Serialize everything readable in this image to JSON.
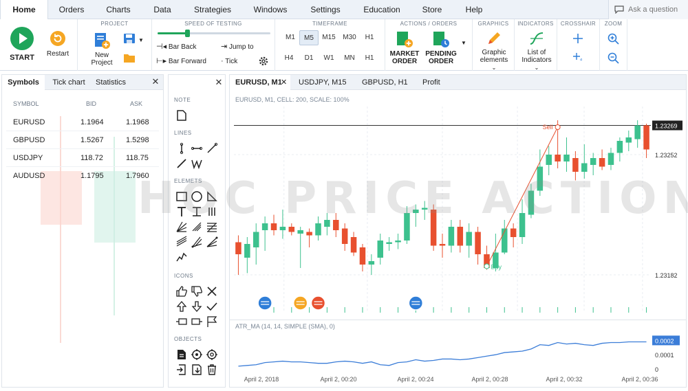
{
  "menu": {
    "items": [
      "Home",
      "Orders",
      "Charts",
      "Data",
      "Strategies",
      "Windows",
      "Settings",
      "Education",
      "Store",
      "Help"
    ],
    "ask": "Ask a question"
  },
  "toolbar": {
    "start": "START",
    "restart": "Restart",
    "project_label": "PROJECT",
    "new_project_l1": "New",
    "new_project_l2": "Project",
    "speed_label": "SPEED OF TESTING",
    "speed_value": 0.26,
    "bar_back": "Bar Back",
    "bar_forward": "Bar Forward",
    "jump_to": "Jump to",
    "tick": "Tick",
    "timeframe_label": "TIMEFRAME",
    "timeframes_row1": [
      "M1",
      "M5",
      "M15",
      "M30",
      "H1"
    ],
    "timeframes_row2": [
      "H4",
      "D1",
      "W1",
      "MN",
      "H1"
    ],
    "timeframe_selected": "M5",
    "actions_label": "ACTIONS  /  ORDERS",
    "market_order_l1": "MARKET",
    "market_order_l2": "ORDER",
    "pending_order_l1": "PENDING",
    "pending_order_l2": "ORDER",
    "graphics_label": "GRAPHICS",
    "graphic_elements_l1": "Graphic",
    "graphic_elements_l2": "elements",
    "indicators_label": "INDICATORS",
    "list_indicators_l1": "List of",
    "list_indicators_l2": "Indicators",
    "crosshair_label": "CROSSHAIR",
    "zoom_label": "ZOOM"
  },
  "symbols_panel": {
    "tabs": [
      "Symbols",
      "Tick chart",
      "Statistics"
    ],
    "headers": [
      "SYMBOL",
      "BID",
      "ASK"
    ],
    "rows": [
      {
        "symbol": "EURUSD",
        "bid": "1.1964",
        "ask": "1.1968"
      },
      {
        "symbol": "GBPUSD",
        "bid": "1.5267",
        "ask": "1.5298"
      },
      {
        "symbol": "USDJPY",
        "bid": "118.72",
        "ask": "118.75"
      },
      {
        "symbol": "AUDUSD",
        "bid": "1.1795",
        "ask": "1.7960"
      }
    ]
  },
  "tools_panel": {
    "sections": [
      "NOTE",
      "LINES",
      "ELEMETS",
      "ICONS",
      "OBJECTS"
    ]
  },
  "chart_tabs": [
    "EURUSD, M1",
    "USDJPY, M15",
    "GBPUSD, H1",
    "Profit"
  ],
  "chart_info": "EURUSD, M1, CELL: 200, SCALE: 100%",
  "watermark": "HOC PRICE ACTION",
  "colors": {
    "bull": "#3dc18e",
    "bear": "#e8502f",
    "indicator": "#3b7dd8",
    "accent_green": "#1fa55a",
    "accent_orange": "#f5a623",
    "accent_blue": "#2f7ed8"
  },
  "chart_data": {
    "type": "candlestick",
    "symbol": "EURUSD",
    "price_labels": [
      "1.23269",
      "1.23252",
      "1.23182"
    ],
    "current_price": "1.23269",
    "ylim": [
      1.2316,
      1.2328
    ],
    "x_labels": [
      "April 2, 2018",
      "April 2, 00:20",
      "April 2, 00:24",
      "April 2, 00:28",
      "April 2, 00:32",
      "April 2, 00:36"
    ],
    "sell_label": "Sell",
    "buy_label": "Buy",
    "candles": [
      {
        "o": 1.23201,
        "h": 1.23205,
        "l": 1.23182,
        "c": 1.23194
      },
      {
        "o": 1.23192,
        "h": 1.23204,
        "l": 1.23183,
        "c": 1.232
      },
      {
        "o": 1.23198,
        "h": 1.23212,
        "l": 1.23188,
        "c": 1.23207
      },
      {
        "o": 1.23208,
        "h": 1.23216,
        "l": 1.23196,
        "c": 1.23212
      },
      {
        "o": 1.23212,
        "h": 1.23217,
        "l": 1.23205,
        "c": 1.23208
      },
      {
        "o": 1.23208,
        "h": 1.2322,
        "l": 1.23203,
        "c": 1.2321
      },
      {
        "o": 1.2321,
        "h": 1.23212,
        "l": 1.23205,
        "c": 1.23207
      },
      {
        "o": 1.23206,
        "h": 1.2321,
        "l": 1.23186,
        "c": 1.23208
      },
      {
        "o": 1.23207,
        "h": 1.23209,
        "l": 1.23198,
        "c": 1.23205
      },
      {
        "o": 1.23205,
        "h": 1.23216,
        "l": 1.23202,
        "c": 1.23212
      },
      {
        "o": 1.2321,
        "h": 1.23218,
        "l": 1.23205,
        "c": 1.23214
      },
      {
        "o": 1.23214,
        "h": 1.23218,
        "l": 1.23204,
        "c": 1.23208
      },
      {
        "o": 1.23209,
        "h": 1.23212,
        "l": 1.23196,
        "c": 1.232
      },
      {
        "o": 1.23204,
        "h": 1.23207,
        "l": 1.23193,
        "c": 1.23195
      },
      {
        "o": 1.23198,
        "h": 1.232,
        "l": 1.23184,
        "c": 1.23188
      },
      {
        "o": 1.23188,
        "h": 1.23194,
        "l": 1.23182,
        "c": 1.2319
      },
      {
        "o": 1.23192,
        "h": 1.23206,
        "l": 1.23188,
        "c": 1.23202
      },
      {
        "o": 1.232,
        "h": 1.23204,
        "l": 1.23196,
        "c": 1.23201
      },
      {
        "o": 1.23201,
        "h": 1.23206,
        "l": 1.23197,
        "c": 1.23202
      },
      {
        "o": 1.23202,
        "h": 1.23222,
        "l": 1.232,
        "c": 1.23218
      },
      {
        "o": 1.23218,
        "h": 1.23223,
        "l": 1.2321,
        "c": 1.2322
      },
      {
        "o": 1.2322,
        "h": 1.23225,
        "l": 1.23214,
        "c": 1.23221
      },
      {
        "o": 1.2322,
        "h": 1.23223,
        "l": 1.23196,
        "c": 1.23199
      },
      {
        "o": 1.232,
        "h": 1.23206,
        "l": 1.23192,
        "c": 1.23199
      },
      {
        "o": 1.23199,
        "h": 1.23214,
        "l": 1.23195,
        "c": 1.2321
      },
      {
        "o": 1.2321,
        "h": 1.23214,
        "l": 1.23195,
        "c": 1.23199
      },
      {
        "o": 1.23199,
        "h": 1.23212,
        "l": 1.23192,
        "c": 1.23207
      },
      {
        "o": 1.23207,
        "h": 1.2321,
        "l": 1.23188,
        "c": 1.23194
      },
      {
        "o": 1.23194,
        "h": 1.23199,
        "l": 1.23185,
        "c": 1.23186
      },
      {
        "o": 1.23186,
        "h": 1.23206,
        "l": 1.23184,
        "c": 1.23195
      },
      {
        "o": 1.23195,
        "h": 1.23214,
        "l": 1.23194,
        "c": 1.23209
      },
      {
        "o": 1.23209,
        "h": 1.23212,
        "l": 1.23198,
        "c": 1.23204
      },
      {
        "o": 1.23204,
        "h": 1.23226,
        "l": 1.232,
        "c": 1.23218
      },
      {
        "o": 1.23217,
        "h": 1.23235,
        "l": 1.23215,
        "c": 1.23231
      },
      {
        "o": 1.23231,
        "h": 1.23255,
        "l": 1.23228,
        "c": 1.23245
      },
      {
        "o": 1.23246,
        "h": 1.23257,
        "l": 1.2324,
        "c": 1.23252
      },
      {
        "o": 1.23252,
        "h": 1.23272,
        "l": 1.23244,
        "c": 1.23248
      },
      {
        "o": 1.23248,
        "h": 1.23262,
        "l": 1.23242,
        "c": 1.23252
      },
      {
        "o": 1.2325,
        "h": 1.23254,
        "l": 1.23237,
        "c": 1.23242
      },
      {
        "o": 1.23242,
        "h": 1.23258,
        "l": 1.23238,
        "c": 1.23247
      },
      {
        "o": 1.23246,
        "h": 1.23253,
        "l": 1.2324,
        "c": 1.2325
      },
      {
        "o": 1.2325,
        "h": 1.23255,
        "l": 1.23243,
        "c": 1.23245
      },
      {
        "o": 1.23246,
        "h": 1.23256,
        "l": 1.23243,
        "c": 1.23253
      },
      {
        "o": 1.23253,
        "h": 1.23262,
        "l": 1.23248,
        "c": 1.2326
      },
      {
        "o": 1.23259,
        "h": 1.23266,
        "l": 1.23254,
        "c": 1.23262
      },
      {
        "o": 1.23261,
        "h": 1.23272,
        "l": 1.23256,
        "c": 1.23269
      },
      {
        "o": 1.23269,
        "h": 1.2327,
        "l": 1.2325,
        "c": 1.23255
      }
    ],
    "indicator": {
      "name": "ATR_MA (14, 14, SIMPLE (SMA), 0)",
      "labels": [
        "0.0002",
        "0.0001",
        "0"
      ],
      "current_value": "0.0002",
      "ylim": [
        0,
        0.00025
      ],
      "values": [
        2e-05,
        2.5e-05,
        3e-05,
        4.5e-05,
        5e-05,
        5.5e-05,
        5e-05,
        5e-05,
        4.5e-05,
        4e-05,
        4e-05,
        5e-05,
        5.5e-05,
        5e-05,
        4e-05,
        5e-05,
        3e-05,
        2.5e-05,
        4.5e-05,
        5e-05,
        6.5e-05,
        5.5e-05,
        6e-05,
        7e-05,
        7e-05,
        6.5e-05,
        7e-05,
        8e-05,
        9e-05,
        0.0001,
        0.000115,
        0.00012,
        0.000125,
        0.00014,
        0.00017,
        0.000165,
        0.000185,
        0.000175,
        0.00018,
        0.00017,
        0.000165,
        0.00018,
        0.000185,
        0.000185,
        0.00019,
        0.00019,
        0.00019
      ]
    }
  }
}
